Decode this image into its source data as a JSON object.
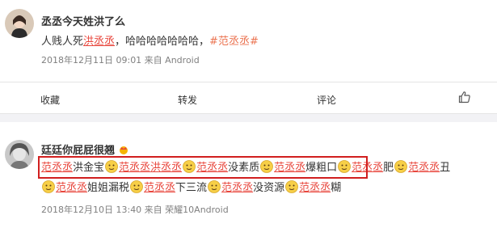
{
  "post1": {
    "username": "丞丞今天姓洪了么",
    "content_prefix": "人贱人死",
    "content_highlight": "洪丞丞",
    "content_middle": "，哈哈哈哈哈哈哈，",
    "content_topic": "#范丞丞#",
    "meta": "2018年12月11日 09:01 来自 Android"
  },
  "actions": {
    "fav": "收藏",
    "repost": "转发",
    "comment": "评论",
    "like_icon": "thumbs-up-icon"
  },
  "post2": {
    "username": "廷廷你屁屁很翘",
    "line1": [
      {
        "t": "hl",
        "v": "范丞丞"
      },
      {
        "t": "txt",
        "v": "洪金宝"
      },
      {
        "t": "emoji"
      },
      {
        "t": "hl",
        "v": "范丞丞"
      },
      {
        "t": "hl",
        "v": "洪丞丞"
      },
      {
        "t": "emoji"
      },
      {
        "t": "hl",
        "v": "范丞丞"
      },
      {
        "t": "txt",
        "v": "没素质"
      },
      {
        "t": "emoji"
      },
      {
        "t": "hl",
        "v": "范丞丞"
      },
      {
        "t": "txt",
        "v": "爆粗口"
      },
      {
        "t": "emoji"
      },
      {
        "t": "hl",
        "v": "范丞丞"
      },
      {
        "t": "txt",
        "v": "肥"
      },
      {
        "t": "emoji"
      },
      {
        "t": "hl",
        "v": "范丞丞"
      },
      {
        "t": "txt",
        "v": "丑"
      }
    ],
    "line2": [
      {
        "t": "emoji"
      },
      {
        "t": "hl",
        "v": "范丞丞"
      },
      {
        "t": "txt",
        "v": "姐姐漏税"
      },
      {
        "t": "emoji"
      },
      {
        "t": "hl",
        "v": "范丞丞"
      },
      {
        "t": "txt",
        "v": "下三流"
      },
      {
        "t": "emoji"
      },
      {
        "t": "hl",
        "v": "范丞丞"
      },
      {
        "t": "txt",
        "v": "没资源"
      },
      {
        "t": "emoji"
      },
      {
        "t": "hl",
        "v": "范丞丞"
      },
      {
        "t": "txt",
        "v": "糊"
      }
    ],
    "meta": "2018年12月10日 13:40 来自 荣耀10Android"
  },
  "colors": {
    "highlight": "#e8463c",
    "topic": "#eb7350",
    "box": "#d11f1f"
  }
}
